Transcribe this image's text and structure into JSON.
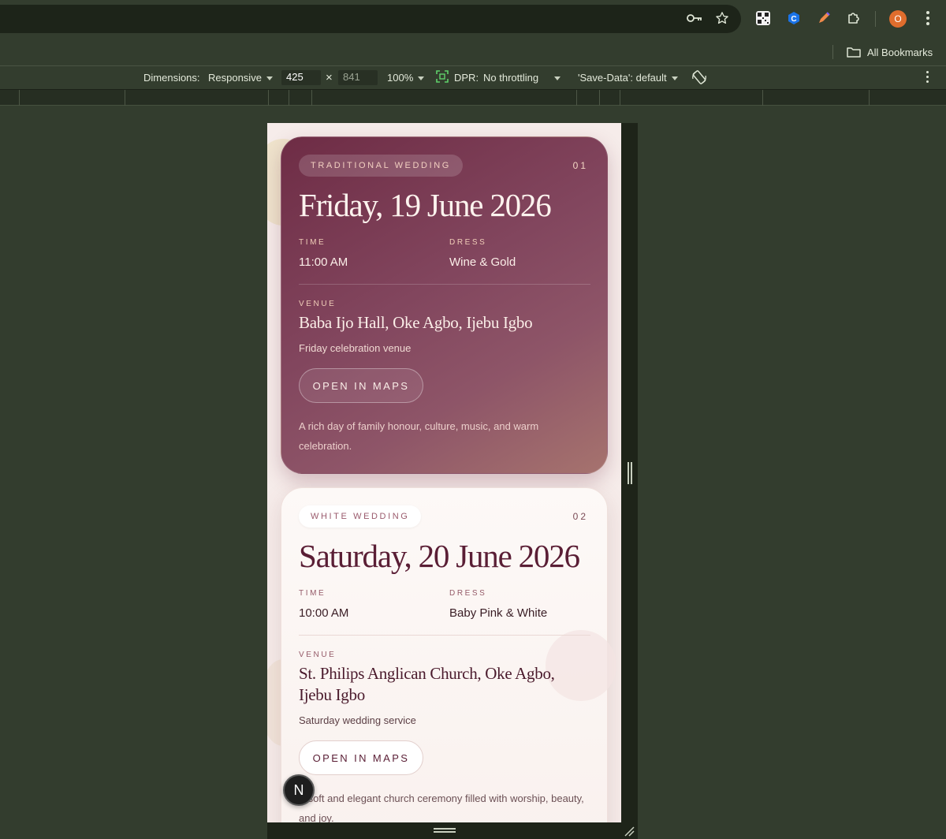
{
  "toolbar": {
    "bookmarks_label": "All Bookmarks",
    "avatar_letter": "O"
  },
  "device_toolbar": {
    "dimensions_label": "Dimensions:",
    "dimensions_value": "Responsive",
    "width": "425",
    "times": "×",
    "height": "841",
    "zoom": "100%",
    "dpr_label": "DPR:",
    "throttling": "No throttling",
    "save_data": "'Save-Data': default"
  },
  "events": [
    {
      "tag": "TRADITIONAL WEDDING",
      "number": "01",
      "date": "Friday, 19 June 2026",
      "time_label": "TIME",
      "time": "11:00 AM",
      "dress_label": "DRESS",
      "dress": "Wine & Gold",
      "venue_label": "VENUE",
      "venue": "Baba Ijo Hall, Oke Agbo, Ijebu Igbo",
      "venue_note": "Friday celebration venue",
      "maps_label": "OPEN IN MAPS",
      "description": "A rich day of family honour, culture, music, and warm celebration."
    },
    {
      "tag": "WHITE WEDDING",
      "number": "02",
      "date": "Saturday, 20 June 2026",
      "time_label": "TIME",
      "time": "10:00 AM",
      "dress_label": "DRESS",
      "dress": "Baby Pink & White",
      "venue_label": "VENUE",
      "venue": "St. Philips Anglican Church, Oke Agbo, Ijebu Igbo",
      "venue_note": "Saturday wedding service",
      "maps_label": "OPEN IN MAPS",
      "description": "A soft and elegant church ceremony filled with worship, beauty, and joy."
    }
  ],
  "nextjs_badge": "N",
  "colors": {
    "card1_start": "#6e2c45",
    "card1_end": "#a6736e",
    "accent_gold": "#f0cdb8",
    "wine_text": "#5a1e35"
  }
}
